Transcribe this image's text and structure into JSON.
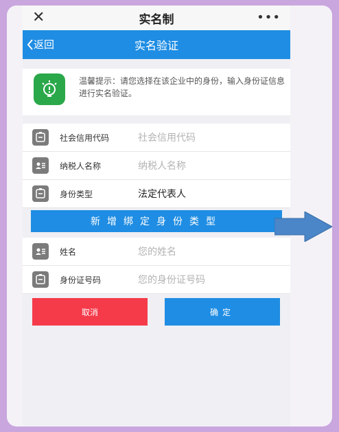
{
  "window": {
    "title": "实名制",
    "close_glyph": "✕",
    "more_glyph": "•••"
  },
  "nav": {
    "back_label": "返回",
    "title": "实名验证"
  },
  "tip": {
    "text": "温馨提示：请您选择在该企业中的身份，输入身份证信息进行实名验证。",
    "icon": "lightbulb-icon"
  },
  "fields": [
    {
      "label": "社会信用代码",
      "placeholder": "社会信用代码",
      "icon": "id-card-icon"
    },
    {
      "label": "纳税人名称",
      "placeholder": "纳税人名称",
      "icon": "contact-card-icon"
    },
    {
      "label": "身份类型",
      "value": "法定代表人",
      "icon": "id-card-icon"
    }
  ],
  "add_button": "新增绑定身份类型",
  "person_fields": [
    {
      "label": "姓名",
      "placeholder": "您的姓名",
      "icon": "contact-card-icon"
    },
    {
      "label": "身份证号码",
      "placeholder": "您的身份证号码",
      "icon": "id-card-icon"
    }
  ],
  "buttons": {
    "cancel": "取消",
    "confirm": "确定"
  },
  "colors": {
    "primary": "#1f8de3",
    "danger": "#f53a4a",
    "accent_icon": "#2aa84a",
    "border": "#c9a6de",
    "arrow": "#4a86c8"
  }
}
